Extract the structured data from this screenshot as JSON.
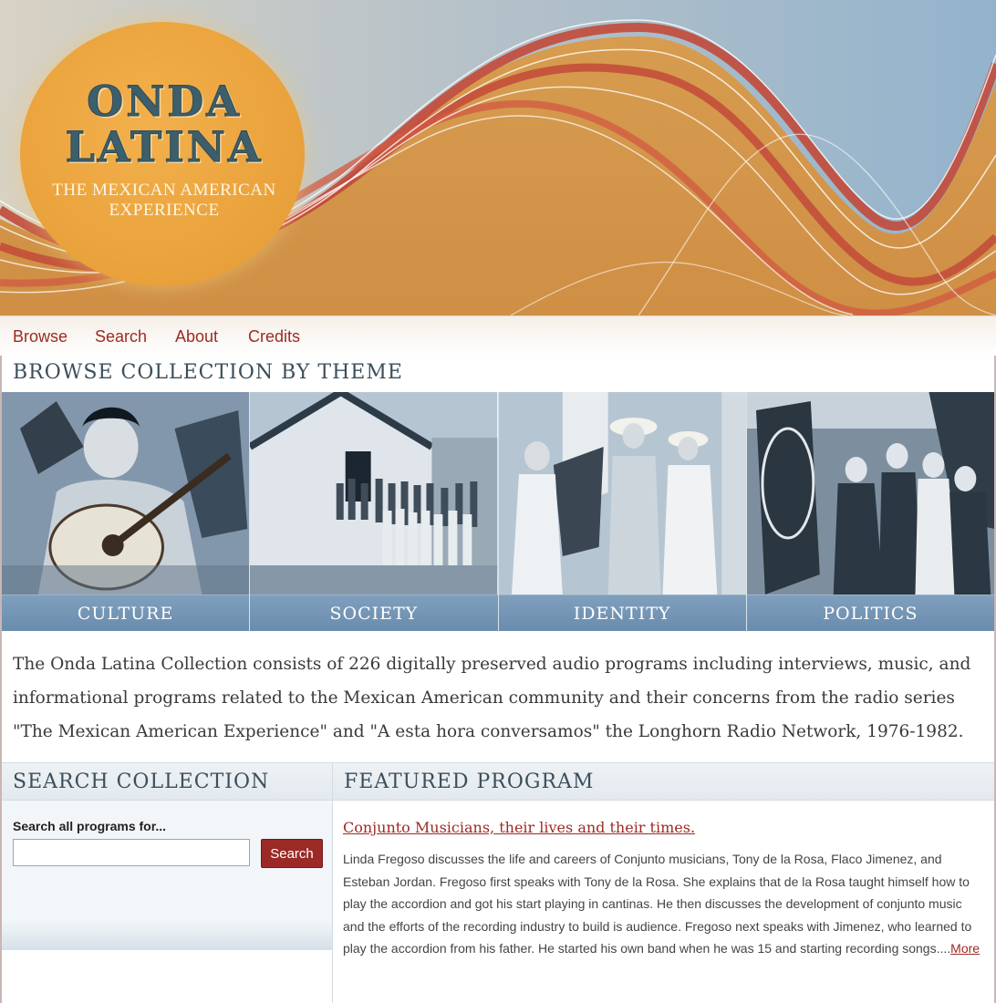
{
  "header": {
    "logo_line1": "ONDA",
    "logo_line2": "LATINA",
    "logo_subtitle_line1": "THE MEXICAN AMERICAN",
    "logo_subtitle_line2": "EXPERIENCE"
  },
  "nav": {
    "items": [
      {
        "label": "Browse"
      },
      {
        "label": "Search"
      },
      {
        "label": "About"
      },
      {
        "label": "Credits"
      }
    ]
  },
  "browse": {
    "title": "BROWSE COLLECTION BY THEME",
    "themes": [
      {
        "label": "CULTURE"
      },
      {
        "label": "SOCIETY"
      },
      {
        "label": "IDENTITY"
      },
      {
        "label": "POLITICS"
      }
    ]
  },
  "description": "The Onda Latina Collection consists of 226 digitally preserved audio programs including interviews, music, and informational programs related to the Mexican American community and their concerns from the radio series \"The Mexican American Experience\" and \"A esta hora conversamos\" the Longhorn Radio Network, 1976-1982.",
  "search": {
    "title": "SEARCH COLLECTION",
    "label": "Search all programs for...",
    "input_value": "",
    "button_label": "Search"
  },
  "featured": {
    "title": "FEATURED PROGRAM",
    "program_title": "Conjunto Musicians, their lives and their times.",
    "program_text": "Linda Fregoso discusses the life and careers of Conjunto musicians, Tony de la Rosa, Flaco Jimenez, and Esteban Jordan. Fregoso first speaks with Tony de la Rosa. She explains that de la Rosa taught himself how to play the accordion and got his start playing in cantinas. He then discusses the development of conjunto music and the efforts of the recording industry to build is audience. Fregoso next speaks with Jimenez, who learned to play the accordion from his father. He started his own band when he was 15 and starting recording songs....",
    "more_label": "More"
  },
  "colors": {
    "accent_red": "#9c2a24",
    "theme_bar": "#6a8cad",
    "sun_orange": "#eba43e",
    "heading_slate": "#3c4f5a"
  }
}
